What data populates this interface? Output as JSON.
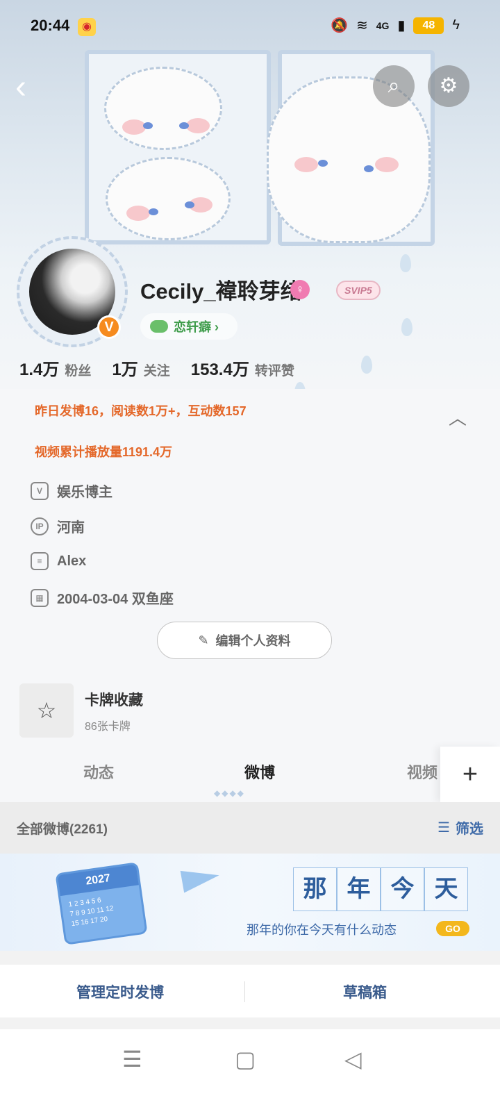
{
  "status_bar": {
    "time": "20:44",
    "signal_label": "4G",
    "battery": "48"
  },
  "profile": {
    "username": "Cecily_褘聆芽绪",
    "svip_label": "SVIP5",
    "chaohua_label": "恋轩癖 ›",
    "stats": [
      {
        "num": "1.4万",
        "label": "粉丝"
      },
      {
        "num": "1万",
        "label": "关注"
      },
      {
        "num": "153.4万",
        "label": "转评赞"
      }
    ],
    "highlight_1": "昨日发博16，阅读数1万+，互动数157",
    "highlight_2": "视频累计播放量1191.4万",
    "info": {
      "role": "娱乐博主",
      "ip": "河南",
      "bio": "Alex",
      "birthday": "2004-03-04 双鱼座"
    },
    "edit_label": "编辑个人资料"
  },
  "cards": {
    "title": "卡牌收藏",
    "sub": "86张卡牌"
  },
  "tabs": {
    "tab1": "动态",
    "tab2": "微博",
    "tab3": "视频"
  },
  "filter": {
    "left": "全部微博(2261)",
    "right": "筛选"
  },
  "promo": {
    "chars": [
      "那",
      "年",
      "今",
      "天"
    ],
    "sub": "那年的你在今天有什么动态",
    "go": "GO",
    "cal_year": "2027"
  },
  "actions": {
    "left": "管理定时发博",
    "right": "草稿箱"
  },
  "colors": {
    "accent_orange": "#e4682a",
    "link_blue": "#3e6aa8",
    "vip_orange": "#f68b1f"
  }
}
